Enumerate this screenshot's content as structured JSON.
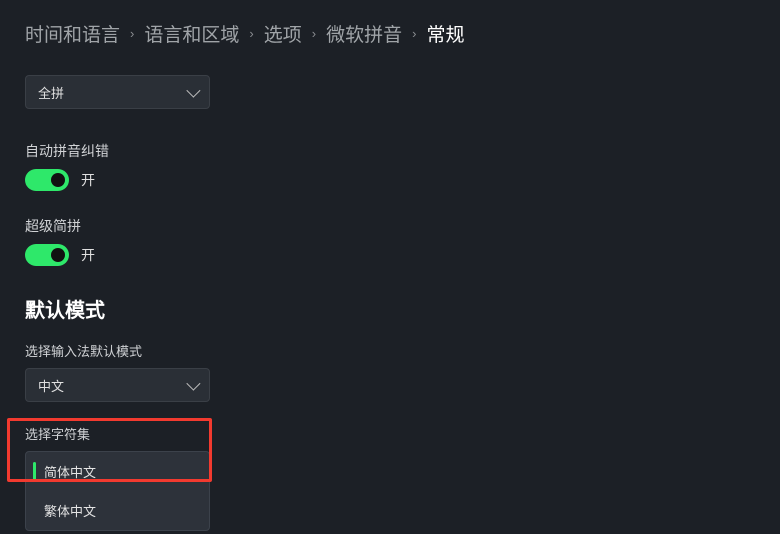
{
  "breadcrumb": {
    "items": [
      "时间和语言",
      "语言和区域",
      "选项",
      "微软拼音"
    ],
    "current": "常规"
  },
  "pinyinType": {
    "value": "全拼"
  },
  "autoCorrect": {
    "label": "自动拼音纠错",
    "state": "开"
  },
  "superJianpin": {
    "label": "超级简拼",
    "state": "开"
  },
  "defaultModeHeading": "默认模式",
  "inputModeField": {
    "label": "选择输入法默认模式",
    "value": "中文"
  },
  "charsetField": {
    "label": "选择字符集",
    "options": [
      {
        "label": "简体中文",
        "selected": true
      },
      {
        "label": "繁体中文",
        "selected": false
      }
    ]
  }
}
